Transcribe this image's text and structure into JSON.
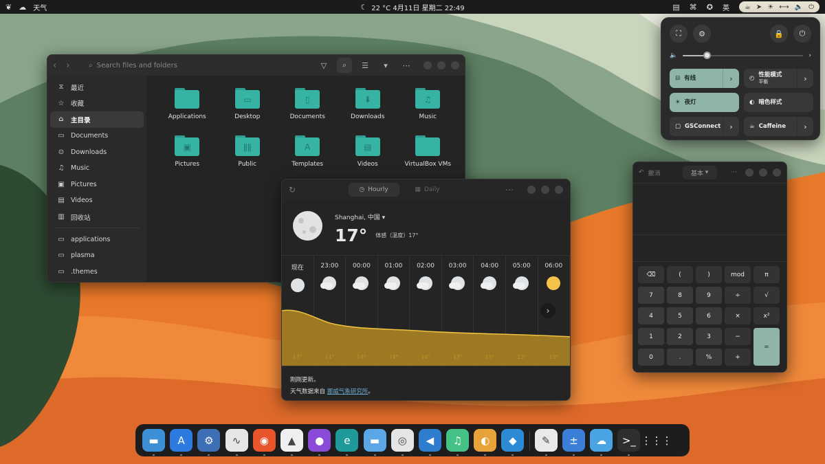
{
  "topbar": {
    "app_name": "天气",
    "status": "22 °C  4月11日 星期二  22:49",
    "lang": "英"
  },
  "files": {
    "search_placeholder": "Search files and folders",
    "sidebar": [
      {
        "label": "最近",
        "icon": "clock-icon"
      },
      {
        "label": "收藏",
        "icon": "star-icon"
      },
      {
        "label": "主目录",
        "icon": "home-icon",
        "selected": true
      },
      {
        "label": "Documents",
        "icon": "document-icon"
      },
      {
        "label": "Downloads",
        "icon": "download-icon"
      },
      {
        "label": "Music",
        "icon": "music-icon"
      },
      {
        "label": "Pictures",
        "icon": "picture-icon"
      },
      {
        "label": "Videos",
        "icon": "video-icon"
      },
      {
        "label": "回收站",
        "icon": "trash-icon"
      }
    ],
    "bookmarks": [
      {
        "label": "applications",
        "icon": "folder-icon"
      },
      {
        "label": "plasma",
        "icon": "folder-icon"
      },
      {
        "label": ".themes",
        "icon": "folder-icon"
      }
    ],
    "folders": [
      {
        "label": "Applications",
        "glyph": ""
      },
      {
        "label": "Desktop",
        "glyph": "▭"
      },
      {
        "label": "Documents",
        "glyph": "▯"
      },
      {
        "label": "Downloads",
        "glyph": "⬇"
      },
      {
        "label": "Music",
        "glyph": "♫"
      },
      {
        "label": "Pictures",
        "glyph": "▣"
      },
      {
        "label": "Public",
        "glyph": "ǁǁ"
      },
      {
        "label": "Templates",
        "glyph": "A"
      },
      {
        "label": "Videos",
        "glyph": "▤"
      },
      {
        "label": "VirtualBox VMs",
        "glyph": ""
      }
    ]
  },
  "weather": {
    "tab_hourly": "Hourly",
    "tab_daily": "Daily",
    "location": "Shanghai, 中国",
    "temp": "17°",
    "feels": "体感（温度）17°",
    "hours": [
      {
        "label": "现在",
        "temp": "17°",
        "icon": "moon"
      },
      {
        "label": "23:00",
        "temp": "14°",
        "icon": "cloud"
      },
      {
        "label": "00:00",
        "temp": "14°",
        "icon": "cloud"
      },
      {
        "label": "01:00",
        "temp": "14°",
        "icon": "cloud"
      },
      {
        "label": "02:00",
        "temp": "14°",
        "icon": "cloud"
      },
      {
        "label": "03:00",
        "temp": "13°",
        "icon": "cloud"
      },
      {
        "label": "04:00",
        "temp": "13°",
        "icon": "cloud"
      },
      {
        "label": "05:00",
        "temp": "13°",
        "icon": "cloud"
      },
      {
        "label": "06:00",
        "temp": "13°",
        "icon": "sun"
      }
    ],
    "updated": "刚刚更新。",
    "source_prefix": "天气数据来自 ",
    "source_link": "挪威气象研究所",
    "source_suffix": "。"
  },
  "quicksettings": {
    "volume": 0.2,
    "toggles": [
      {
        "label": "有线",
        "sub": "",
        "on": true,
        "arrow": true,
        "icon": "network-icon"
      },
      {
        "label": "性能模式",
        "sub": "平衡",
        "on": false,
        "arrow": true,
        "icon": "power-mode-icon"
      },
      {
        "label": "夜灯",
        "sub": "",
        "on": true,
        "arrow": false,
        "icon": "night-light-icon"
      },
      {
        "label": "暗色样式",
        "sub": "",
        "on": false,
        "arrow": false,
        "icon": "dark-style-icon"
      },
      {
        "label": "GSConnect",
        "sub": "",
        "on": false,
        "arrow": true,
        "icon": "phone-icon"
      },
      {
        "label": "Caffeine",
        "sub": "",
        "on": false,
        "arrow": true,
        "icon": "coffee-icon"
      }
    ]
  },
  "calculator": {
    "undo": "撤消",
    "mode": "基本",
    "keys": [
      {
        "label": "⌫",
        "cls": "dark"
      },
      {
        "label": "(",
        "cls": "dark"
      },
      {
        "label": ")",
        "cls": "dark"
      },
      {
        "label": "mod",
        "cls": "dark"
      },
      {
        "label": "π",
        "cls": "dark"
      },
      {
        "label": "7",
        "cls": ""
      },
      {
        "label": "8",
        "cls": ""
      },
      {
        "label": "9",
        "cls": ""
      },
      {
        "label": "÷",
        "cls": "dark"
      },
      {
        "label": "√",
        "cls": "dark"
      },
      {
        "label": "4",
        "cls": ""
      },
      {
        "label": "5",
        "cls": ""
      },
      {
        "label": "6",
        "cls": ""
      },
      {
        "label": "×",
        "cls": "dark"
      },
      {
        "label": "x²",
        "cls": "dark"
      },
      {
        "label": "1",
        "cls": ""
      },
      {
        "label": "2",
        "cls": ""
      },
      {
        "label": "3",
        "cls": ""
      },
      {
        "label": "−",
        "cls": "dark"
      },
      {
        "label": "=",
        "cls": "eq"
      },
      {
        "label": "0",
        "cls": ""
      },
      {
        "label": ".",
        "cls": ""
      },
      {
        "label": "%",
        "cls": ""
      },
      {
        "label": "+",
        "cls": "dark"
      }
    ]
  },
  "dock": [
    {
      "name": "files-app",
      "bg": "#3d8fd6",
      "glyph": "▬"
    },
    {
      "name": "app-store",
      "bg": "#2d7be0",
      "glyph": "A"
    },
    {
      "name": "settings-app",
      "bg": "#3f6fb5",
      "glyph": "⚙"
    },
    {
      "name": "system-monitor",
      "bg": "#e6e6e6",
      "glyph": "∿"
    },
    {
      "name": "firefox",
      "bg": "#e8552a",
      "glyph": "◉"
    },
    {
      "name": "inkscape",
      "bg": "#efefef",
      "glyph": "▲"
    },
    {
      "name": "github",
      "bg": "#8a4bd8",
      "glyph": "●"
    },
    {
      "name": "edge",
      "bg": "#1f9a9a",
      "glyph": "e"
    },
    {
      "name": "folder-app",
      "bg": "#5aa6e6",
      "glyph": "▬"
    },
    {
      "name": "browser",
      "bg": "#e5e5e5",
      "glyph": "◎"
    },
    {
      "name": "vscode",
      "bg": "#2f7dcf",
      "glyph": "◀"
    },
    {
      "name": "music-app",
      "bg": "#45c286",
      "glyph": "♫"
    },
    {
      "name": "color-picker",
      "bg": "#e8a23a",
      "glyph": "◐"
    },
    {
      "name": "virtualbox",
      "bg": "#2d8bd6",
      "glyph": "◆"
    },
    {
      "name": "text-editor",
      "bg": "#e9e9e9",
      "glyph": "✎"
    },
    {
      "name": "calculator-app",
      "bg": "#3b7fd9",
      "glyph": "±"
    },
    {
      "name": "weather-app",
      "bg": "#4aa3e3",
      "glyph": "☁"
    },
    {
      "name": "terminal",
      "bg": "#2e2e2e",
      "glyph": ">_"
    },
    {
      "name": "app-grid",
      "bg": "transparent",
      "glyph": "⋮⋮⋮"
    }
  ]
}
